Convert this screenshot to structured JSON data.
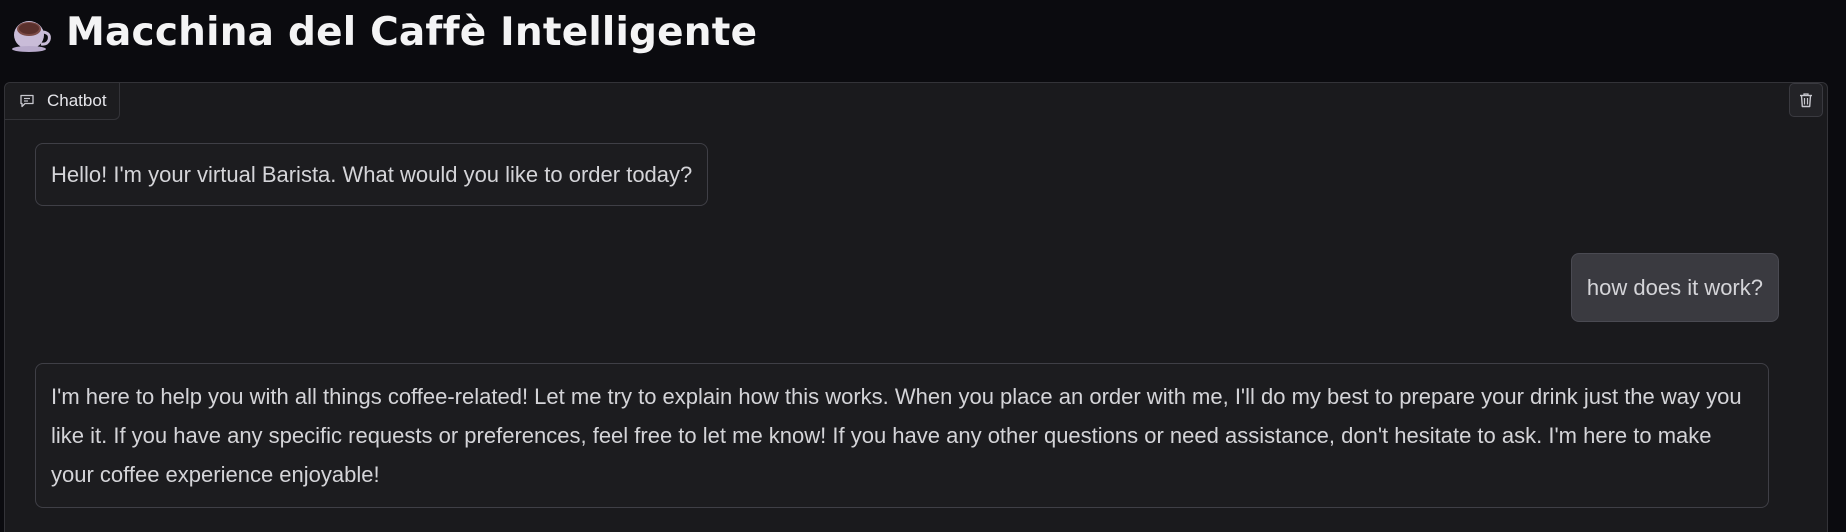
{
  "header": {
    "title": "Macchina del Caffè Intelligente",
    "icon": "coffee-cup-icon"
  },
  "chatbot": {
    "label": "Chatbot",
    "label_icon": "chat-bubble-icon",
    "clear_icon": "trash-icon",
    "messages": [
      {
        "role": "bot",
        "text": "Hello! I'm your virtual Barista. What would you like to order today?"
      },
      {
        "role": "user",
        "text": "how does it work?"
      },
      {
        "role": "bot",
        "text": "I'm here to help you with all things coffee-related! Let me try to explain how this works. When you place an order with me, I'll do my best to prepare your drink just the way you like it. If you have any specific requests or preferences, feel free to let me know! If you have any other questions or need assistance, don't hesitate to ask. I'm here to make your coffee experience enjoyable!"
      }
    ]
  },
  "colors": {
    "page_background": "#0b0b0f",
    "panel_background": "#1a1a1d",
    "user_bubble": "#3a3a40",
    "text": "#d4d4d8"
  }
}
